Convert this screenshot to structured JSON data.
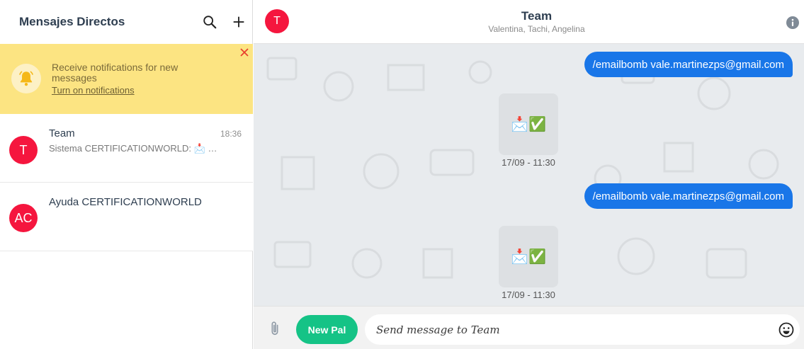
{
  "sidebar": {
    "title": "Mensajes Directos",
    "search_icon": "search-icon",
    "add_icon": "plus-icon"
  },
  "notification": {
    "text": "Receive notifications for new messages",
    "link": "Turn on notifications",
    "icon": "bell-icon",
    "close_icon": "close-icon"
  },
  "conversations": [
    {
      "initial": "T",
      "name": "Team",
      "time": "18:36",
      "preview": "Sistema CERTIFICATIONWORLD: 📩 …"
    },
    {
      "initial": "AC",
      "name": "Ayuda CERTIFICATIONWORLD",
      "time": "",
      "preview": ""
    }
  ],
  "chat": {
    "avatar_initial": "T",
    "title": "Team",
    "members": "Valentina, Tachi, Angelina",
    "info_icon": "info-icon"
  },
  "messages": [
    {
      "type": "outgoing",
      "text": "/emailbomb vale.martinezps@gmail.com"
    },
    {
      "type": "system",
      "content": "📩✅",
      "timestamp": "17/09 - 11:30"
    },
    {
      "type": "outgoing",
      "text": "/emailbomb vale.martinezps@gmail.com"
    },
    {
      "type": "system",
      "content": "📩✅",
      "timestamp": "17/09 - 11:30"
    }
  ],
  "composer": {
    "attach_icon": "paperclip-icon",
    "new_pal_label": "New Pal",
    "placeholder": "Send message to Team",
    "emoji_icon": "smiley-icon"
  },
  "colors": {
    "accent_red": "#f5163e",
    "bubble_blue": "#1976e8",
    "button_green": "#15c386",
    "notification_yellow": "#fce482"
  }
}
